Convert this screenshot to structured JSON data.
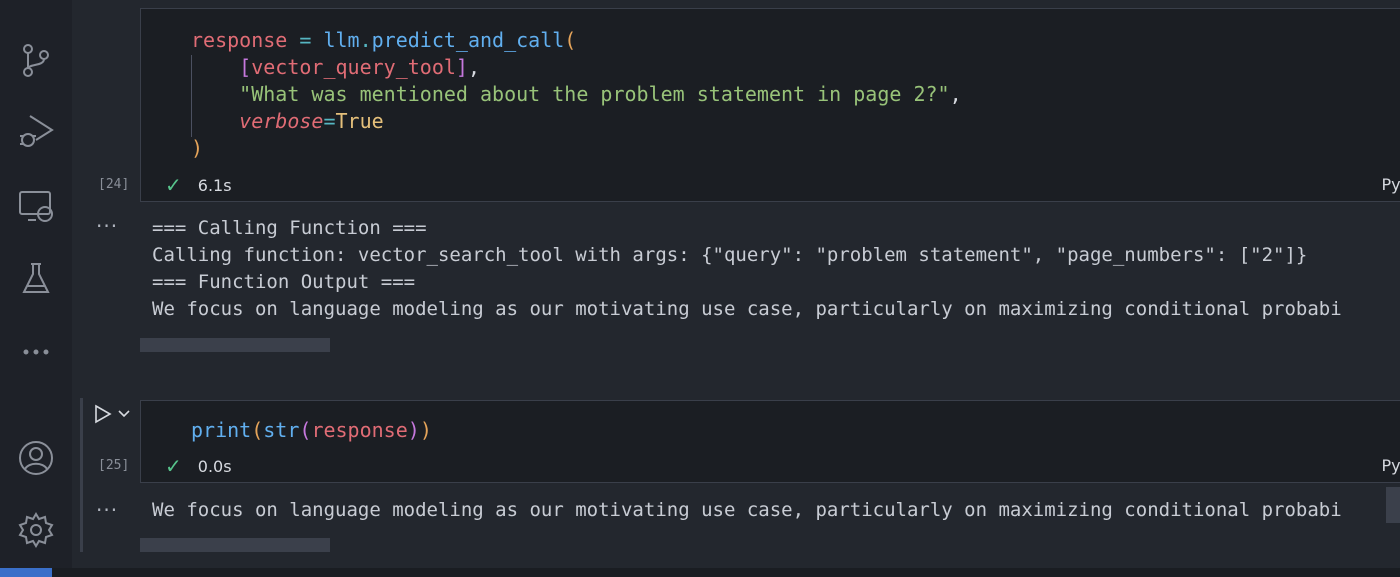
{
  "activity_bar": {
    "icons": [
      "source-control-icon",
      "run-debug-icon",
      "remote-explorer-icon",
      "testing-icon",
      "more-icon",
      "account-icon",
      "settings-icon"
    ]
  },
  "cell1": {
    "exec_count": "[24]",
    "code": {
      "l1_var": "response",
      "l1_eq": " = ",
      "l1_obj": "llm",
      "l1_dot": ".",
      "l1_fn": "predict_and_call",
      "l1_paren": "(",
      "l2_open": "[",
      "l2_name": "vector_query_tool",
      "l2_close": "]",
      "l2_comma": ",",
      "l3_str": "\"What was mentioned about the problem statement in page 2?\"",
      "l3_comma": ",",
      "l4_param": "verbose",
      "l4_eq": "=",
      "l4_val": "True",
      "l5_paren": ")"
    },
    "time": "6.1s",
    "language": "Python",
    "output_lines": [
      "=== Calling Function ===",
      "Calling function: vector_search_tool with args: {\"query\": \"problem statement\", \"page_numbers\": [\"2\"]}",
      "=== Function Output ===",
      "We focus on language modeling as our motivating use case, particularly on maximizing conditional probabi"
    ]
  },
  "cell2": {
    "exec_count": "[25]",
    "code": {
      "fn": "print",
      "p1": "(",
      "fn2": "str",
      "p2": "(",
      "arg": "response",
      "p3": ")",
      "p4": ")"
    },
    "time": "0.0s",
    "language": "Python",
    "output_lines": [
      "We focus on language modeling as our motivating use case, particularly on maximizing conditional probabi"
    ]
  },
  "colors": {
    "accent_check": "#57c48c",
    "remote_indicator": "#3a6fc9"
  }
}
